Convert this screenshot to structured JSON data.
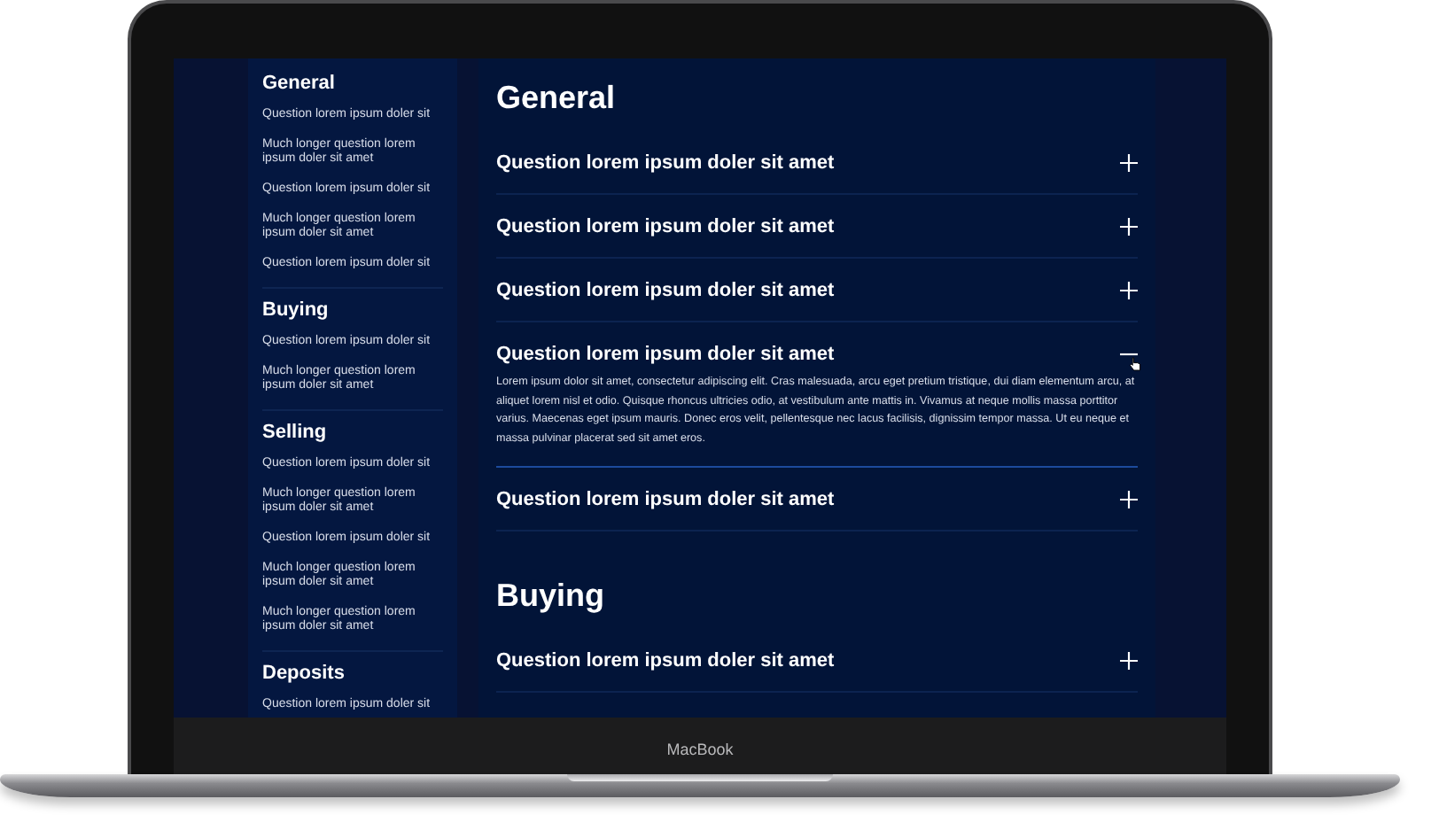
{
  "laptop": {
    "brand": "MacBook"
  },
  "sidebar": {
    "sections": [
      {
        "title": "General",
        "items": [
          "Question lorem ipsum doler sit",
          "Much longer question lorem ipsum doler sit amet",
          "Question lorem ipsum doler sit",
          "Much longer question lorem ipsum doler sit amet",
          "Question lorem ipsum doler sit"
        ]
      },
      {
        "title": "Buying",
        "items": [
          "Question lorem ipsum doler sit",
          "Much longer question lorem ipsum doler sit amet"
        ]
      },
      {
        "title": "Selling",
        "items": [
          "Question lorem ipsum doler sit",
          "Much longer question lorem ipsum doler sit amet",
          "Question lorem ipsum doler sit",
          "Much longer question lorem ipsum doler sit amet",
          "Much longer question lorem ipsum doler sit amet"
        ]
      },
      {
        "title": "Deposits",
        "items": [
          "Question lorem ipsum doler sit"
        ]
      }
    ]
  },
  "main": {
    "sections": [
      {
        "title": "General",
        "questions": [
          {
            "text": "Question lorem ipsum doler sit amet",
            "expanded": false
          },
          {
            "text": "Question lorem ipsum doler sit amet",
            "expanded": false
          },
          {
            "text": "Question lorem ipsum doler sit amet",
            "expanded": false
          },
          {
            "text": "Question lorem ipsum doler sit amet",
            "expanded": true,
            "answer": "Lorem ipsum dolor sit amet, consectetur adipiscing elit. Cras malesuada, arcu eget pretium tristique, dui diam elementum arcu, at aliquet lorem nisl et odio. Quisque rhoncus ultricies odio, at vestibulum ante mattis in. Vivamus at neque mollis massa porttitor varius. Maecenas eget ipsum mauris. Donec eros velit, pellentesque nec lacus facilisis, dignissim tempor massa. Ut eu neque et massa pulvinar placerat sed sit amet eros."
          },
          {
            "text": "Question lorem ipsum doler sit amet",
            "expanded": false
          }
        ]
      },
      {
        "title": "Buying",
        "questions": [
          {
            "text": "Question lorem ipsum doler sit amet",
            "expanded": false
          }
        ]
      }
    ]
  }
}
